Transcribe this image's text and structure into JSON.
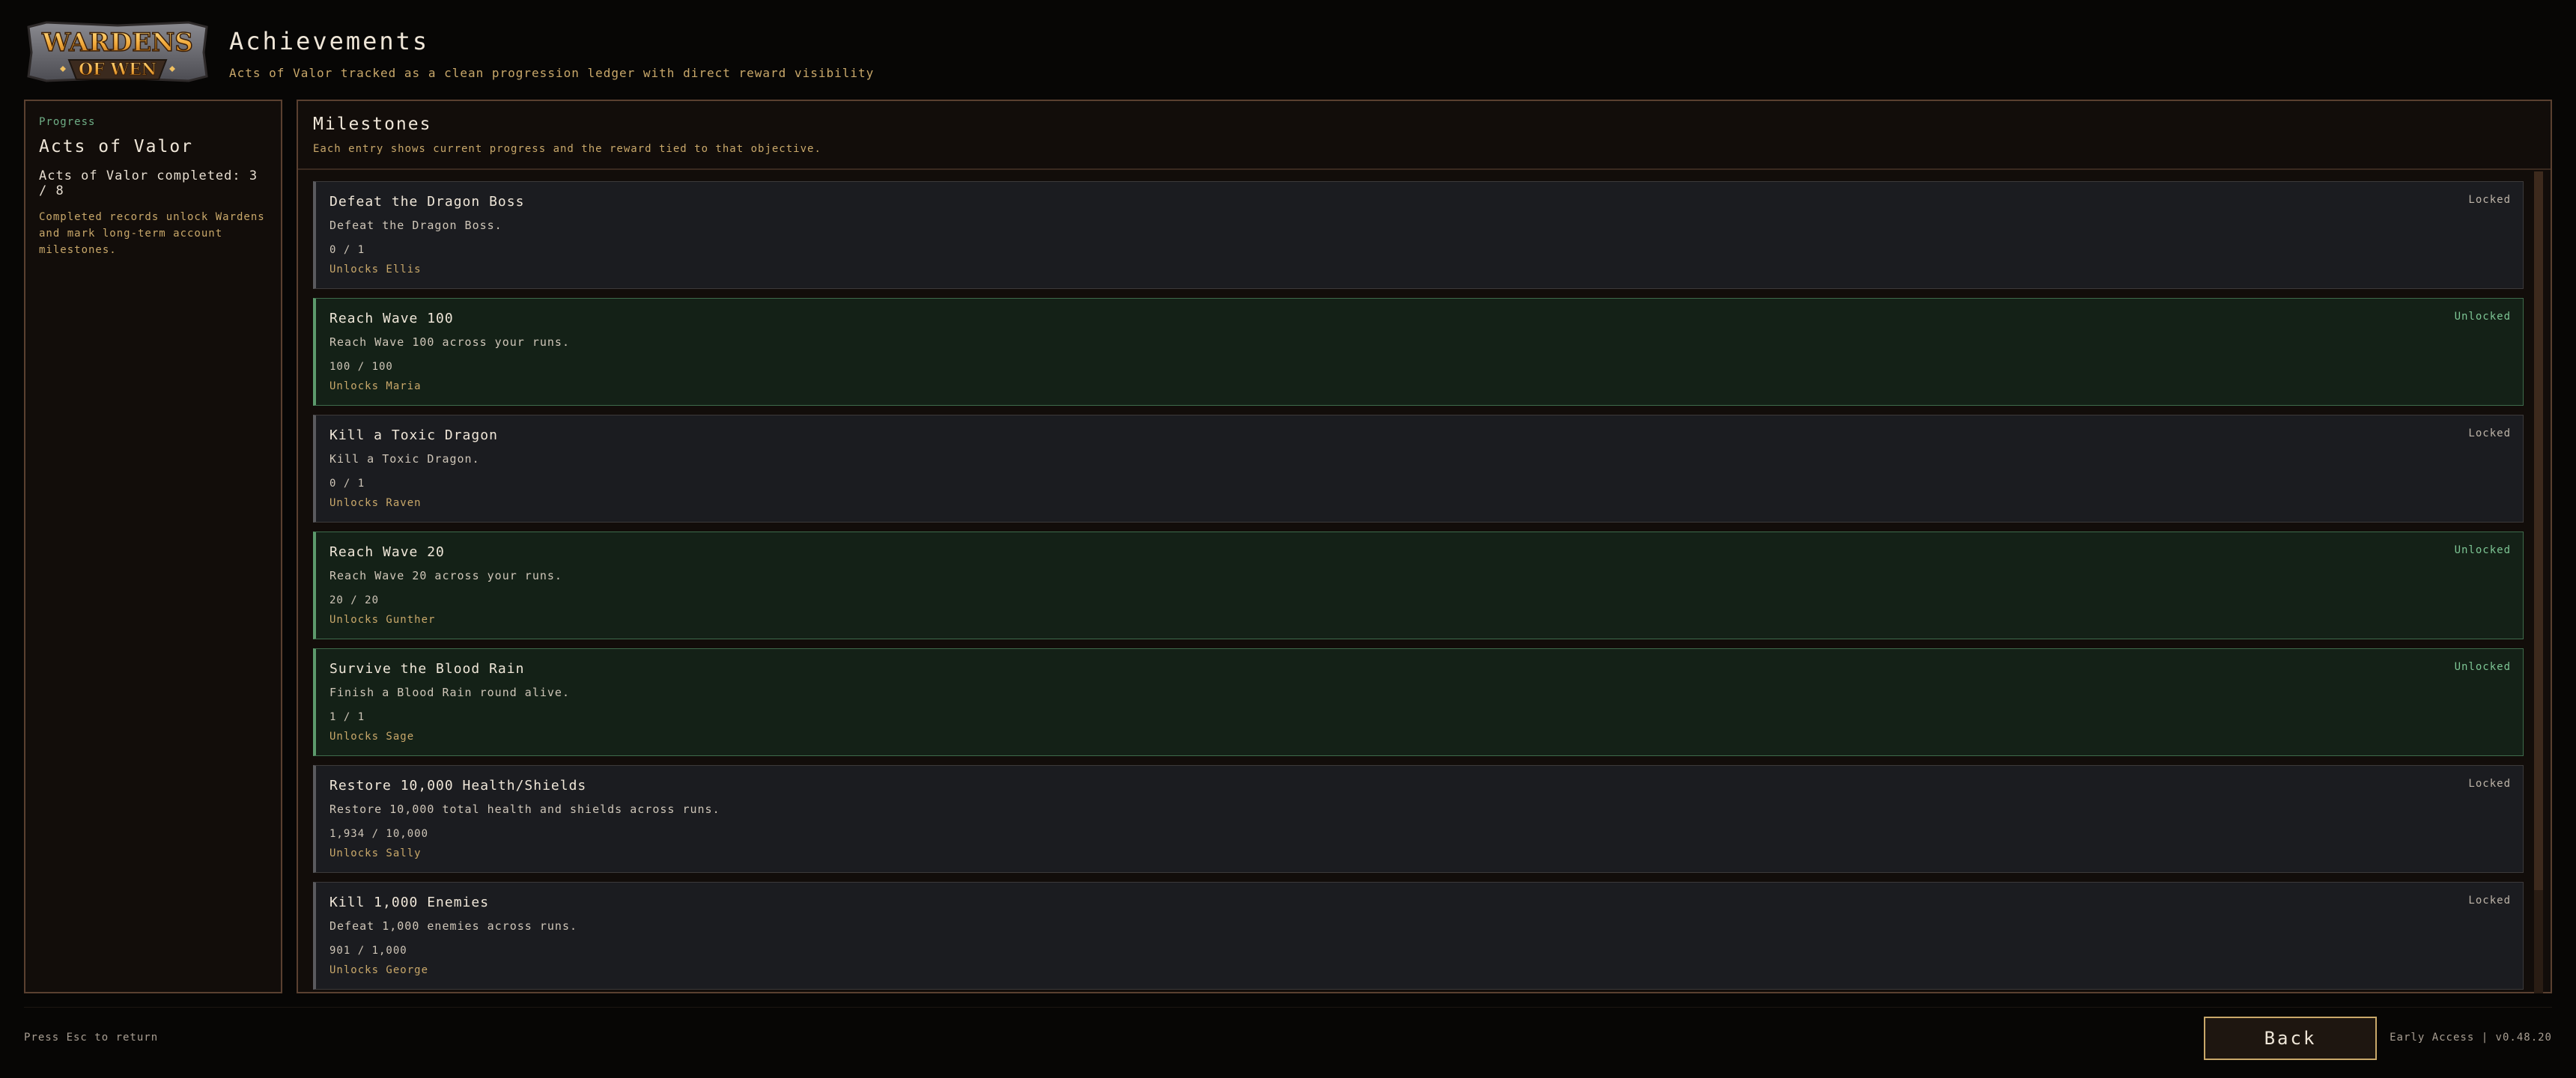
{
  "header": {
    "logo_text": [
      "WARDENS",
      "OF WEN"
    ],
    "title": "Achievements",
    "subtitle": "Acts of Valor tracked as a clean progression ledger with direct reward visibility"
  },
  "left_panel": {
    "kicker": "Progress",
    "title": "Acts of Valor",
    "count": "Acts of Valor completed: 3 / 8",
    "description": "Completed records unlock Wardens and mark long-term account milestones."
  },
  "main_panel": {
    "title": "Milestones",
    "subtitle": "Each entry shows current progress and the reward tied to that objective."
  },
  "milestones": [
    {
      "title": "Defeat the Dragon Boss",
      "desc": "Defeat the Dragon Boss.",
      "progress": "0 / 1",
      "reward": "Unlocks Ellis",
      "status": "Locked",
      "unlocked": false
    },
    {
      "title": "Reach Wave 100",
      "desc": "Reach Wave 100 across your runs.",
      "progress": "100 / 100",
      "reward": "Unlocks Maria",
      "status": "Unlocked",
      "unlocked": true
    },
    {
      "title": "Kill a Toxic Dragon",
      "desc": "Kill a Toxic Dragon.",
      "progress": "0 / 1",
      "reward": "Unlocks Raven",
      "status": "Locked",
      "unlocked": false
    },
    {
      "title": "Reach Wave 20",
      "desc": "Reach Wave 20 across your runs.",
      "progress": "20 / 20",
      "reward": "Unlocks Gunther",
      "status": "Unlocked",
      "unlocked": true
    },
    {
      "title": "Survive the Blood Rain",
      "desc": "Finish a Blood Rain round alive.",
      "progress": "1 / 1",
      "reward": "Unlocks Sage",
      "status": "Unlocked",
      "unlocked": true
    },
    {
      "title": "Restore 10,000 Health/Shields",
      "desc": "Restore 10,000 total health and shields across runs.",
      "progress": "1,934 / 10,000",
      "reward": "Unlocks Sally",
      "status": "Locked",
      "unlocked": false
    },
    {
      "title": "Kill 1,000 Enemies",
      "desc": "Defeat 1,000 enemies across runs.",
      "progress": "901 / 1,000",
      "reward": "Unlocks George",
      "status": "Locked",
      "unlocked": false
    }
  ],
  "footer": {
    "hint": "Press Esc to return",
    "back_label": "Back",
    "version": "Early Access | v0.48.20"
  }
}
